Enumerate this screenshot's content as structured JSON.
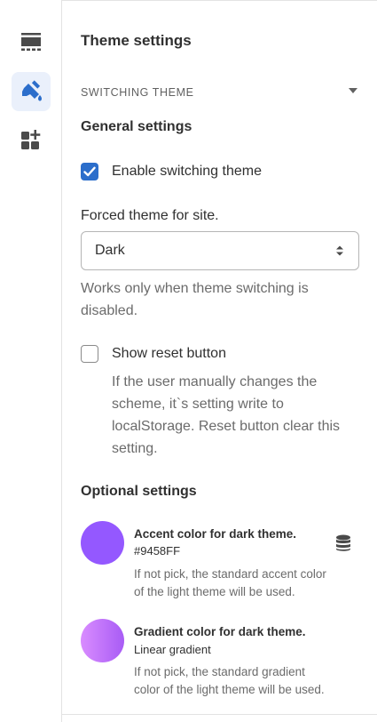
{
  "rail": {
    "items": [
      {
        "icon": "layout-section-icon",
        "active": false
      },
      {
        "icon": "paint-brush-icon",
        "active": true
      },
      {
        "icon": "apps-add-icon",
        "active": false
      }
    ]
  },
  "panel": {
    "title": "Theme settings",
    "section_label": "SWITCHING THEME",
    "general_heading": "General settings",
    "enable_switching": {
      "label": "Enable switching theme",
      "checked": true
    },
    "forced_theme": {
      "label": "Forced theme for site.",
      "value": "Dark",
      "help_line1": "Works only when theme switching is",
      "help_line2": "disabled."
    },
    "reset_button": {
      "label": "Show reset button",
      "checked": false,
      "help_line1": "If the user manually changes the",
      "help_line2": "scheme, it`s setting write to",
      "help_line3": "localStorage. Reset button clear this",
      "help_line4": "setting."
    },
    "optional_heading": "Optional settings",
    "accent": {
      "title": "Accent color for dark theme.",
      "value": "#9458FF",
      "help_line1": "If not pick, the standard accent color",
      "help_line2": "of the light theme will be used."
    },
    "gradient": {
      "title": "Gradient color for dark theme.",
      "value": "Linear gradient",
      "help_line1": "If not pick, the standard gradient",
      "help_line2": "color of the light theme will be used."
    }
  },
  "colors": {
    "accent_swatch": "#9458FF",
    "gradient_start": "#d98cff",
    "gradient_end": "#a85cf5",
    "checkbox_checked": "#2c6ecb",
    "active_icon": "#2c6ecb"
  }
}
